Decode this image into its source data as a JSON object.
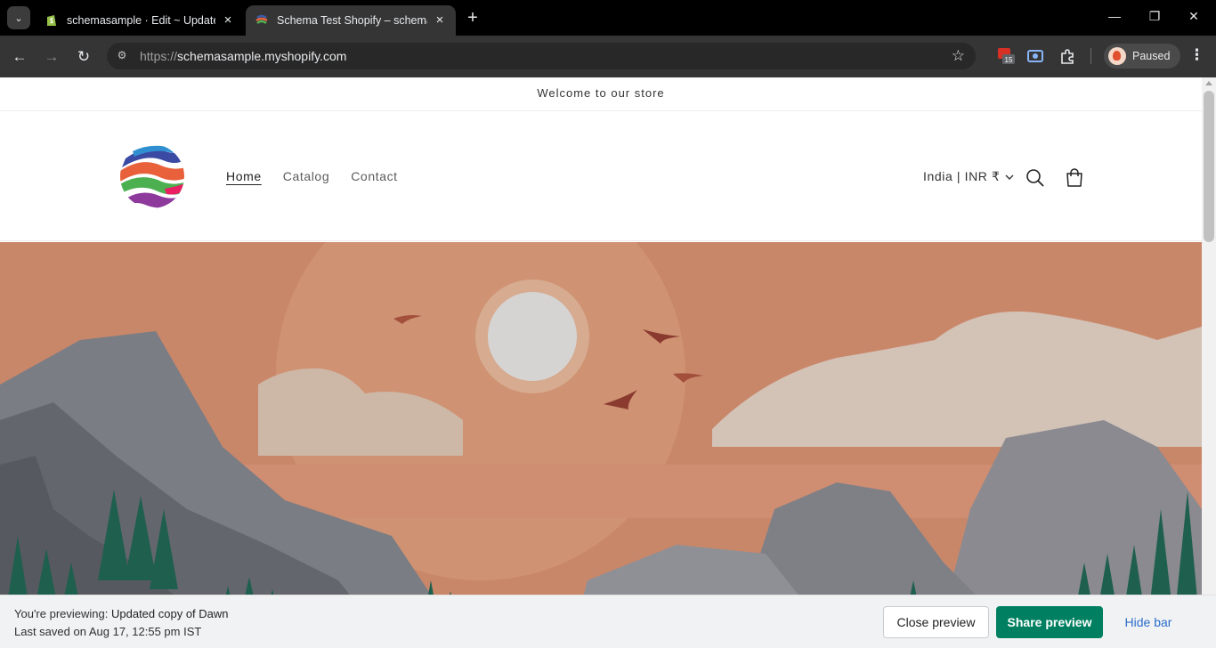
{
  "browser": {
    "tabs": [
      {
        "title": "schemasample · Edit ~ Updated copy of Dawn",
        "active": false
      },
      {
        "title": "Schema Test Shopify – schemasample",
        "active": true
      }
    ],
    "url": {
      "scheme": "https://",
      "host": "schemasample.myshopify.com"
    },
    "extension_badge": "15",
    "profile_label": "Paused"
  },
  "store": {
    "announcement": "Welcome to our store",
    "nav": [
      "Home",
      "Catalog",
      "Contact"
    ],
    "country_selector": "India | INR ₹"
  },
  "preview_bar": {
    "previewing_prefix": "You're previewing:",
    "theme_name": "Updated copy of Dawn",
    "last_saved": "Last saved on Aug 17, 12:55 pm IST",
    "close_label": "Close preview",
    "share_label": "Share preview",
    "hide_label": "Hide bar"
  },
  "colors": {
    "share_button": "#008060",
    "hide_link": "#2c6ecb",
    "hero_sky": "#c9876a"
  }
}
